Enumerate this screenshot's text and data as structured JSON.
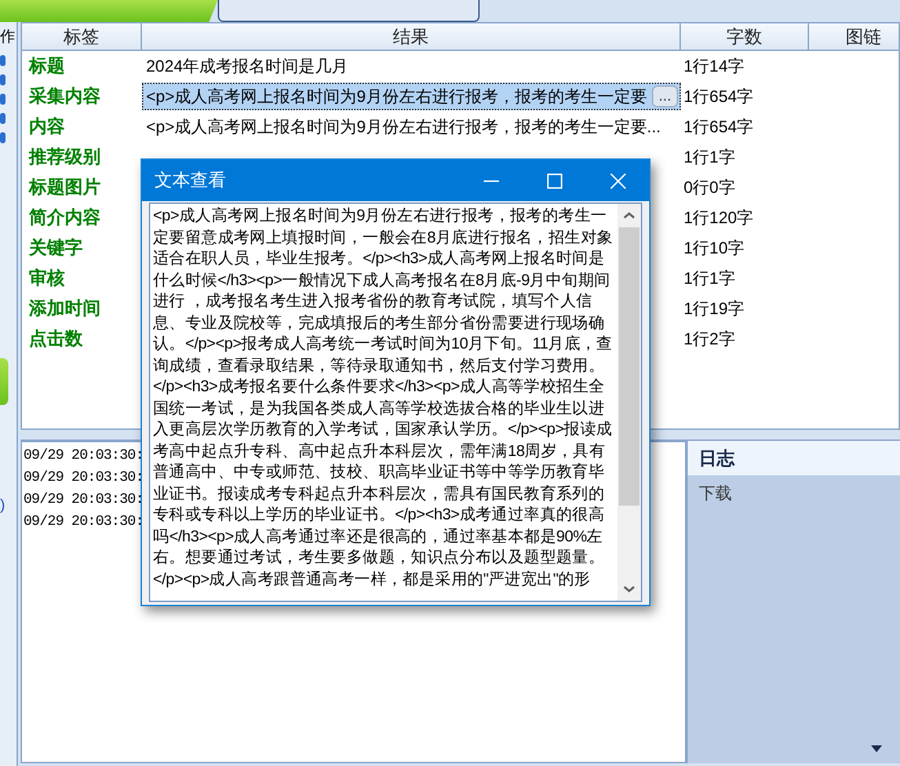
{
  "sidebar": {
    "fragments": [
      "作",
      ")"
    ]
  },
  "table": {
    "columns": [
      "标签",
      "结果",
      "字数",
      "图链"
    ],
    "rows": [
      {
        "label": "标题",
        "result": "2024年成考报名时间是几月",
        "count": "1行14字",
        "selected": false
      },
      {
        "label": "采集内容",
        "result": "<p>成人高考网上报名时间为9月份左右进行报考，报考的考生一定要",
        "count": "1行654字",
        "selected": true,
        "button": "..."
      },
      {
        "label": "内容",
        "result": "<p>成人高考网上报名时间为9月份左右进行报考，报考的考生一定要...",
        "count": "1行654字",
        "selected": false
      },
      {
        "label": "推荐级别",
        "count": "1行1字",
        "selected": false
      },
      {
        "label": "标题图片",
        "count": "0行0字",
        "selected": false
      },
      {
        "label": "简介内容",
        "count": "1行120字",
        "selected": false
      },
      {
        "label": "关键字",
        "count": "1行10字",
        "selected": false
      },
      {
        "label": "审核",
        "count": "1行1字",
        "selected": false
      },
      {
        "label": "添加时间",
        "count": "1行19字",
        "selected": false
      },
      {
        "label": "点击数",
        "count": "1行2字",
        "selected": false
      }
    ]
  },
  "log": {
    "lines": [
      "09/29 20:03:30:",
      "09/29 20:03:30:",
      "09/29 20:03:30:",
      "09/29 20:03:30:"
    ]
  },
  "side_panel": {
    "title": "日志",
    "text": "下载"
  },
  "dialog": {
    "title": "文本查看",
    "lines": [
      "<p>成人高考网上报名时间为9月份左右进行报考，报考的考生一",
      "定要留意成考网上填报时间，一般会在8月底进行报名，招生对象",
      "适合在职人员，毕业生报考。</p><h3>成人高考网上报名时间是",
      "什么时候</h3><p>一般情况下成人高考报名在8月底-9月中旬期间",
      "进行 ，成考报名考生进入报考省份的教育考试院，填写个人信",
      "息、专业及院校等，完成填报后的考生部分省份需要进行现场确",
      "认。</p><p>报考成人高考统一考试时间为10月下旬。11月底，查",
      "询成绩，查看录取结果，等待录取通知书，然后支付学习费用。",
      "</p><h3>成考报名要什么条件要求</h3><p>成人高等学校招生全",
      "国统一考试，是为我国各类成人高等学校选拔合格的毕业生以进",
      "入更高层次学历教育的入学考试，国家承认学历。</p><p>报读成",
      "考高中起点升专科、高中起点升本科层次，需年满18周岁，具有",
      "普通高中、中专或师范、技校、职高毕业证书等中等学历教育毕",
      "业证书。报读成考专科起点升本科层次，需具有国民教育系列的",
      "专科或专科以上学历的毕业证书。</p><h3>成考通过率真的很高",
      "吗</h3><p>成人高考通过率还是很高的，通过率基本都是90%左",
      "右。想要通过考试，考生要多做题，知识点分布以及题型题量。",
      "</p><p>成人高考跟普通高考一样，都是采用的\"严进宽出\"的形"
    ]
  }
}
